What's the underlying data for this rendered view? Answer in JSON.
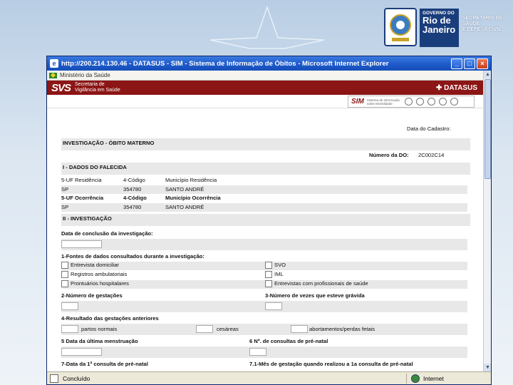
{
  "branding": {
    "gov_line1": "GOVERNO DO",
    "gov_line2": "Rio de",
    "gov_line3": "Janeiro",
    "sec_line1": "SECRETARIA DE",
    "sec_line2": "SAÚDE",
    "sec_line3": "E DEFESA CIVIL"
  },
  "window": {
    "title": "http://200.214.130.46 - DATASUS - SIM - Sistema de Informação de Óbitos - Microsoft Internet Explorer",
    "min": "_",
    "max": "□",
    "close": "×"
  },
  "header": {
    "ministry": "Ministério da Saúde",
    "svs_logo": "SVS",
    "svs_line1": "Secretaria de",
    "svs_line2": "Vigilância em Saúde",
    "datasus": "DATASUS",
    "sim_logo": "SIM",
    "sim_sub": "Sistema de Informação sobre Mortalidade"
  },
  "form": {
    "data_cadastro": "Data do Cadastro:",
    "heading": "INVESTIGAÇÃO - ÓBITO MATERNO",
    "numero_do_label": "Número da DO:",
    "numero_do_value": "2C002C14",
    "section1": "I - DADOS DO FALECIDA",
    "labels_row1": [
      "5-UF Residência",
      "4-Código",
      "Município Residência"
    ],
    "values_row1": [
      "SP",
      "354780",
      "SANTO ANDRÉ"
    ],
    "labels_row2": [
      "5-UF Ocorrência",
      "4-Código",
      "Município Ocorrência"
    ],
    "values_row2": [
      "SP",
      "354780",
      "SANTO ANDRÉ"
    ],
    "section2": "II - INVESTIGAÇÃO",
    "data_conclusao": "Data de conclusão da investigação:",
    "fontes_label": "1-Fontes de dados consultados durante a investigação:",
    "fontes_left": [
      "Entrevista domiciliar",
      "Registros ambulatoriais",
      "Prontuários hospitalares"
    ],
    "fontes_right": [
      "SVO",
      "IML",
      "Entrevistas com profissionais de saúde"
    ],
    "q2": "2-Número de gestações",
    "q3": "3-Número de vezes que esteve grávida",
    "q4": "4-Resultado das gestações anteriores",
    "partos": "partos normais",
    "cesareas": "cesáreas",
    "abortamentos": "abortamentos/perdas fetais",
    "q5": "5 Data da última menstruação",
    "q6": "6 Nº. de consultas de pré-natal",
    "q7": "7-Data da 1ª consulta de pré-natal",
    "q7b": "7.1-Mês de gestação quando realizou a 1a consulta de pré-natal"
  },
  "status": {
    "left": "Concluído",
    "right": "Internet"
  }
}
